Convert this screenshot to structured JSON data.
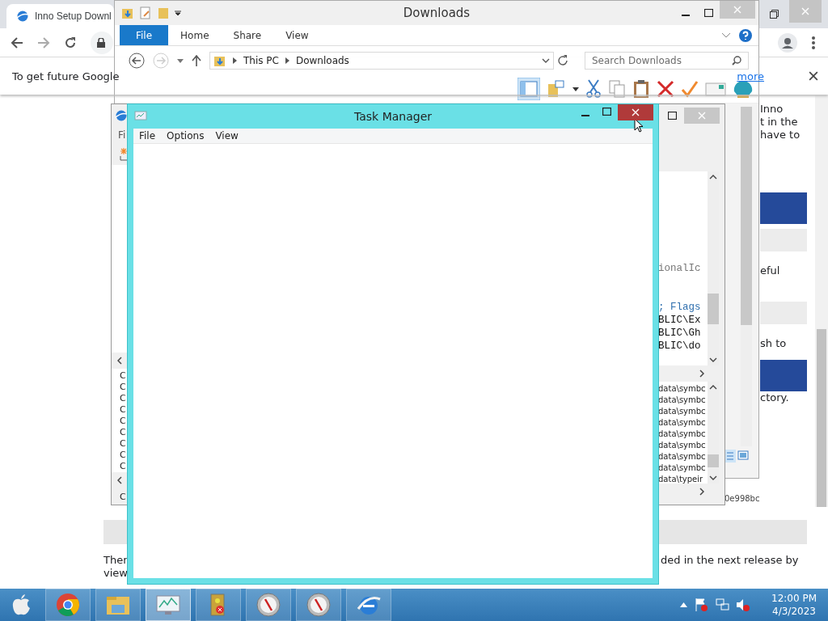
{
  "browser": {
    "tab_title": "Inno Setup Downl",
    "infobar": {
      "text": "To get future Google",
      "link": "more"
    },
    "page": {
      "right_fragments": [
        {
          "kind": "text",
          "text": "Inno"
        },
        {
          "kind": "text",
          "text": "t in the"
        },
        {
          "kind": "text",
          "text": "have to"
        },
        {
          "kind": "banner"
        },
        {
          "kind": "band"
        },
        {
          "kind": "text",
          "text": "eful"
        },
        {
          "kind": "band"
        },
        {
          "kind": "text",
          "text": "sh to"
        },
        {
          "kind": "banner"
        },
        {
          "kind": "text",
          "text": "ctory."
        }
      ],
      "hash_fragment": "0e998bc",
      "bottom_left": [
        "Ther",
        "view"
      ],
      "bottom_right": "ded in the next release by"
    }
  },
  "explorer": {
    "title": "Downloads",
    "ribbon_tabs": [
      {
        "label": "File",
        "selected": true
      },
      {
        "label": "Home",
        "selected": false
      },
      {
        "label": "Share",
        "selected": false
      },
      {
        "label": "View",
        "selected": false
      }
    ],
    "path": [
      "This PC",
      "Downloads"
    ],
    "search": {
      "placeholder": "Search Downloads"
    }
  },
  "editor": {
    "menu": "Fi",
    "code_lines": [
      {
        "kind": "comment",
        "text": "ionalIc"
      },
      {
        "kind": "keyword",
        "text": "; Flags"
      },
      {
        "kind": "plain",
        "text": "BLIC\\Ex"
      },
      {
        "kind": "plain",
        "text": "BLIC\\Gh"
      },
      {
        "kind": "plain",
        "text": "BLIC\\do"
      }
    ],
    "file_list": [
      "data\\symbc",
      "data\\symbc",
      "data\\symbc",
      "data\\symbc",
      "data\\symbc",
      "data\\symbc",
      "data\\symbc",
      "data\\symbc",
      "data\\typeir"
    ],
    "left_letters": [
      "C",
      "C",
      "C",
      "C",
      "C",
      "C",
      "C",
      "C",
      "C"
    ],
    "status": "C"
  },
  "task_manager": {
    "title": "Task Manager",
    "menu": [
      "File",
      "Options",
      "View"
    ],
    "close_hovered": true
  },
  "taskbar": {
    "apps": [
      {
        "kind": "apple",
        "selected": false
      },
      {
        "kind": "chrome",
        "selected": false
      },
      {
        "kind": "explorer",
        "selected": false
      },
      {
        "kind": "taskmgr",
        "selected": true
      },
      {
        "kind": "security",
        "selected": false
      },
      {
        "kind": "compass",
        "selected": false
      },
      {
        "kind": "compass",
        "selected": false
      },
      {
        "kind": "ie",
        "selected": false
      }
    ],
    "clock": {
      "time": "12:00 PM",
      "date": "4/3/2023"
    }
  }
}
